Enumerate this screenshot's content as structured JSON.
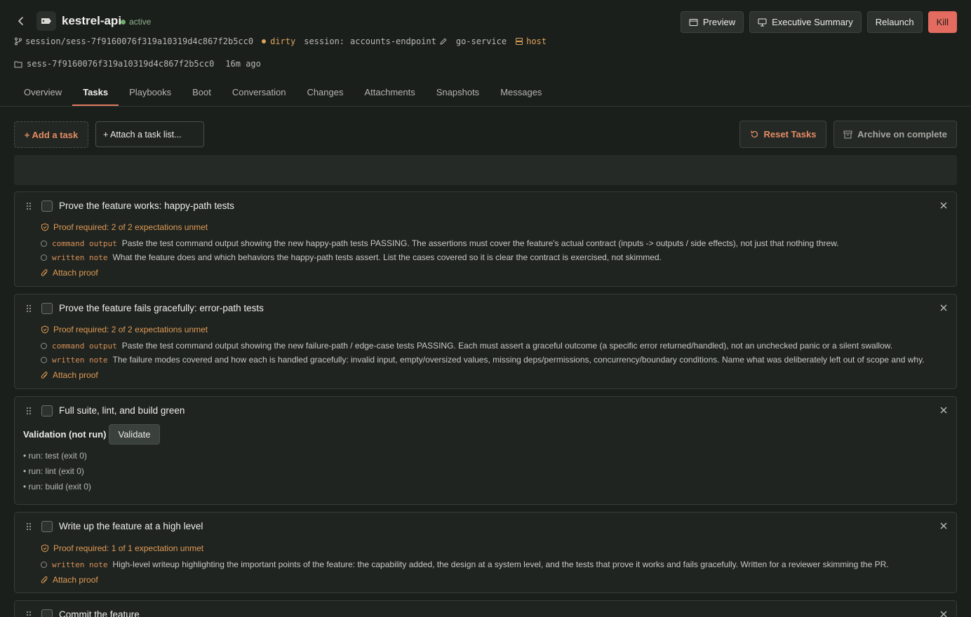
{
  "header": {
    "app_name": "kestrel-api",
    "status": "active",
    "branch": "session/sess-7f9160076f319a10319d4c867f2b5cc0",
    "dirty_label": "dirty",
    "session_label": "session:",
    "session_name": "accounts-endpoint",
    "service": "go-service",
    "host": "host",
    "session_id": "sess-7f9160076f319a10319d4c867f2b5cc0",
    "age": "16m ago",
    "actions": {
      "preview": "Preview",
      "executive_summary": "Executive Summary",
      "relaunch": "Relaunch",
      "kill": "Kill"
    }
  },
  "tabs": [
    "Overview",
    "Tasks",
    "Playbooks",
    "Boot",
    "Conversation",
    "Changes",
    "Attachments",
    "Snapshots",
    "Messages"
  ],
  "active_tab": "Tasks",
  "toolbar": {
    "add_task": "+ Add a task",
    "attach_list": "+ Attach a task list...",
    "reset_tasks": "Reset Tasks",
    "archive": "Archive on complete"
  },
  "tasks": [
    {
      "title": "Prove the feature works: happy-path tests",
      "proof_required": "Proof required: 2 of 2 expectations unmet",
      "expectations": [
        {
          "kind": "command output",
          "text": "Paste the test command output showing the new happy-path tests PASSING. The assertions must cover the feature's actual contract (inputs -> outputs / side effects), not just that nothing threw."
        },
        {
          "kind": "written note",
          "text": "What the feature does and which behaviors the happy-path tests assert. List the cases covered so it is clear the contract is exercised, not skimmed."
        }
      ],
      "attach_proof": "Attach proof"
    },
    {
      "title": "Prove the feature fails gracefully: error-path tests",
      "proof_required": "Proof required: 2 of 2 expectations unmet",
      "expectations": [
        {
          "kind": "command output",
          "text": "Paste the test command output showing the new failure-path / edge-case tests PASSING. Each must assert a graceful outcome (a specific error returned/handled), not an unchecked panic or a silent swallow."
        },
        {
          "kind": "written note",
          "text": "The failure modes covered and how each is handled gracefully: invalid input, empty/oversized values, missing deps/permissions, concurrency/boundary conditions. Name what was deliberately left out of scope and why."
        }
      ],
      "attach_proof": "Attach proof"
    },
    {
      "title": "Full suite, lint, and build green",
      "validation_label": "Validation (not run)",
      "validate_button": "Validate",
      "runs": [
        "• run: test (exit 0)",
        "• run: lint (exit 0)",
        "• run: build (exit 0)"
      ]
    },
    {
      "title": "Write up the feature at a high level",
      "proof_required": "Proof required: 1 of 1 expectation unmet",
      "expectations": [
        {
          "kind": "written note",
          "text": "High-level writeup highlighting the important points of the feature: the capability added, the design at a system level, and the tests that prove it works and fails gracefully. Written for a reviewer skimming the PR."
        }
      ],
      "attach_proof": "Attach proof"
    },
    {
      "title": "Commit the feature"
    }
  ],
  "colors": {
    "accent": "#e58c64",
    "kill": "#e46b5f",
    "active_status": "#6fae6a",
    "proof": "#e09a55"
  }
}
